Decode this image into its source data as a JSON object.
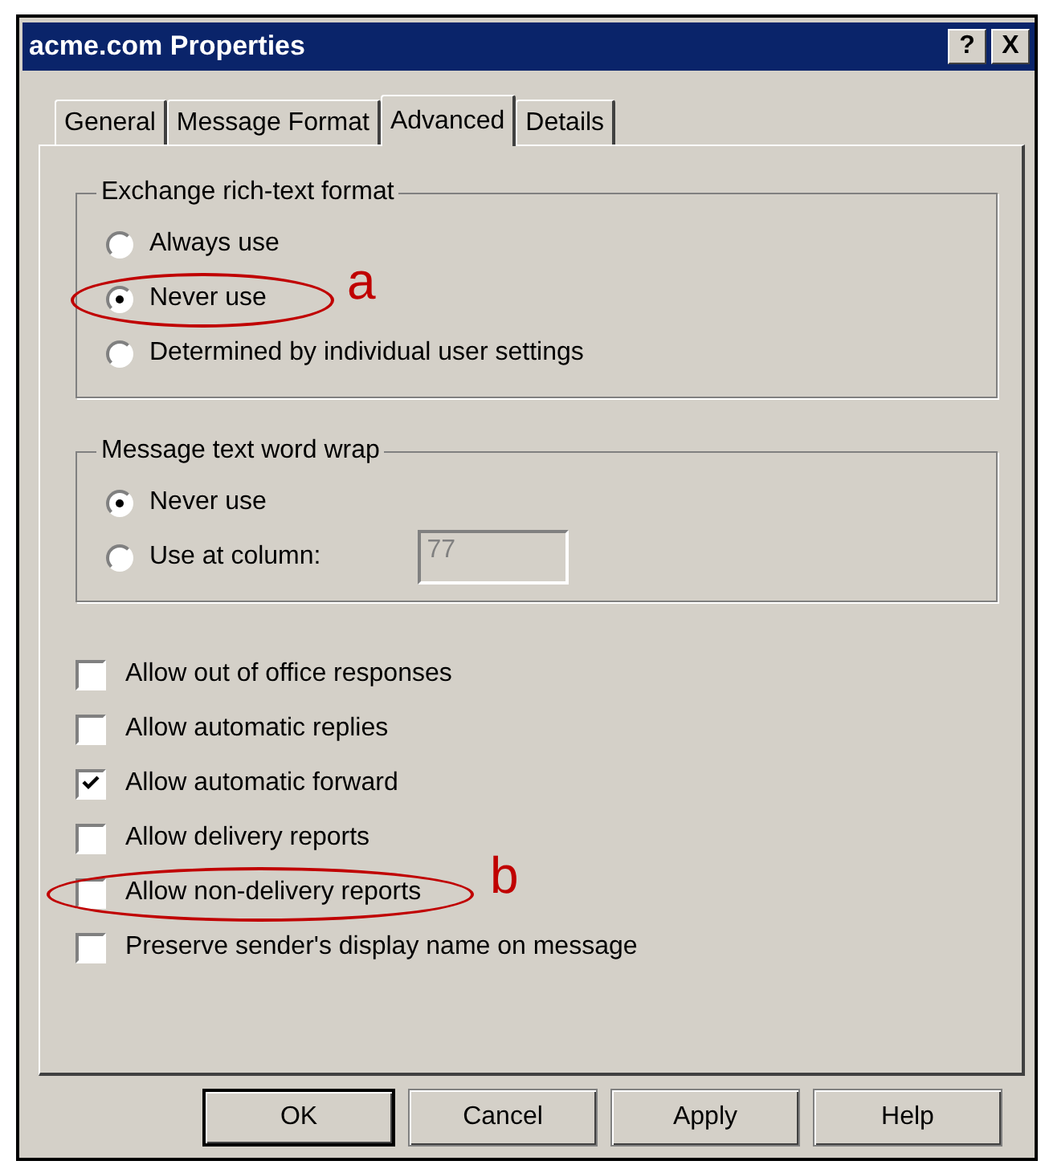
{
  "window": {
    "title": "acme.com Properties",
    "title_buttons": [
      "?",
      "X"
    ]
  },
  "tabs": [
    {
      "label": "General",
      "selected": false
    },
    {
      "label": "Message Format",
      "selected": false
    },
    {
      "label": "Advanced",
      "selected": true
    },
    {
      "label": "Details",
      "selected": false
    }
  ],
  "groups": [
    {
      "title": "Exchange rich-text format",
      "options": [
        {
          "label": "Always use",
          "selected": false
        },
        {
          "label": "Never use",
          "selected": true,
          "annotation": "a"
        },
        {
          "label": "Determined by individual user settings",
          "selected": false
        }
      ]
    },
    {
      "title": "Message text word wrap",
      "options": [
        {
          "label": "Never use",
          "selected": true
        },
        {
          "label": "Use at column:",
          "selected": false,
          "field": {
            "value": "77",
            "disabled": true
          }
        }
      ]
    }
  ],
  "checkboxes": [
    {
      "label": "Allow out of office responses",
      "checked": false
    },
    {
      "label": "Allow automatic replies",
      "checked": false
    },
    {
      "label": "Allow automatic forward",
      "checked": true
    },
    {
      "label": "Allow delivery reports",
      "checked": false
    },
    {
      "label": "Allow non-delivery reports",
      "checked": false,
      "annotation": "b"
    },
    {
      "label": "Preserve sender's display name on message",
      "checked": false
    }
  ],
  "buttons": [
    {
      "label": "OK",
      "default": true
    },
    {
      "label": "Cancel",
      "default": false
    },
    {
      "label": "Apply",
      "default": false
    },
    {
      "label": "Help",
      "default": false
    }
  ]
}
